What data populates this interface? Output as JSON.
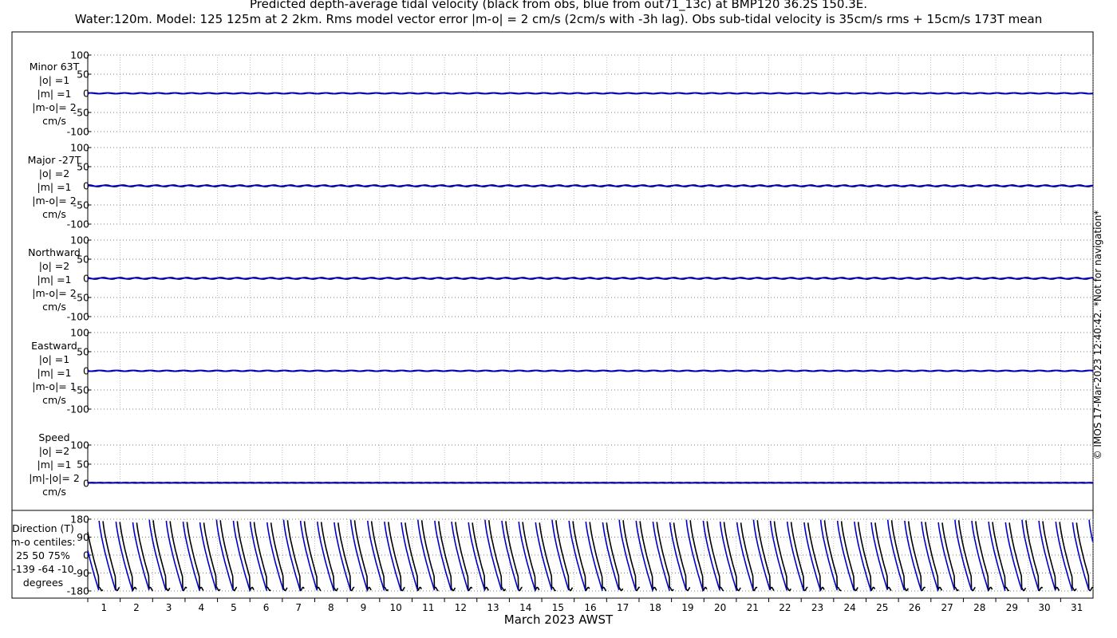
{
  "title_line1": "Predicted depth-average tidal velocity (black from obs, blue from out71_13c) at BMP120 36.2S 150.3E.",
  "title_line2": "Water:120m. Model: 125 125m at 2 2km. Rms model vector error |m-o| = 2 cm/s (2cm/s with -3h lag). Obs sub-tidal velocity is 35cm/s rms + 15cm/s 173T mean",
  "xlabel": "March 2023 AWST",
  "copyright": "© IMOS 17-Mar-2023 12:40:42. *Not for navigation*",
  "colors": {
    "obs": "#000000",
    "model": "#0000cc",
    "grid": "#999999"
  },
  "chart_data": [
    {
      "type": "line",
      "panel": "minor",
      "side_lines": [
        "Minor 63T",
        "|o| =1",
        "|m| =1",
        "|m-o|= 2",
        "cm/s"
      ],
      "yticks": [
        "100",
        "50",
        "0",
        "-50",
        "-100"
      ],
      "ylim": [
        -100,
        100
      ],
      "xlim": [
        0,
        31
      ],
      "series": [
        {
          "name": "obs",
          "amplitude": 1
        },
        {
          "name": "model",
          "amplitude": 1
        }
      ]
    },
    {
      "type": "line",
      "panel": "major",
      "side_lines": [
        "Major -27T",
        "|o| =2",
        "|m| =1",
        "|m-o|= 2",
        "cm/s"
      ],
      "yticks": [
        "100",
        "50",
        "0",
        "-50",
        "-100"
      ],
      "ylim": [
        -100,
        100
      ],
      "xlim": [
        0,
        31
      ],
      "series": [
        {
          "name": "obs",
          "amplitude": 2
        },
        {
          "name": "model",
          "amplitude": 1
        }
      ]
    },
    {
      "type": "line",
      "panel": "northward",
      "side_lines": [
        "Northward",
        "|o| =2",
        "|m| =1",
        "|m-o|= 2",
        "cm/s"
      ],
      "yticks": [
        "100",
        "50",
        "0",
        "-50",
        "-100"
      ],
      "ylim": [
        -100,
        100
      ],
      "xlim": [
        0,
        31
      ],
      "series": [
        {
          "name": "obs",
          "amplitude": 2
        },
        {
          "name": "model",
          "amplitude": 1
        }
      ]
    },
    {
      "type": "line",
      "panel": "eastward",
      "side_lines": [
        "Eastward",
        "|o| =1",
        "|m| =1",
        "|m-o|= 1",
        "cm/s"
      ],
      "yticks": [
        "100",
        "50",
        "0",
        "-50",
        "-100"
      ],
      "ylim": [
        -100,
        100
      ],
      "xlim": [
        0,
        31
      ],
      "series": [
        {
          "name": "obs",
          "amplitude": 1
        },
        {
          "name": "model",
          "amplitude": 1
        }
      ]
    },
    {
      "type": "line",
      "panel": "speed",
      "side_lines": [
        "Speed",
        "|o| =2",
        "|m| =1",
        "|m|-|o|= 2",
        "cm/s"
      ],
      "yticks": [
        "100",
        "50",
        "0"
      ],
      "ylim": [
        0,
        100
      ],
      "xlim": [
        0,
        31
      ],
      "series": [
        {
          "name": "obs",
          "amplitude": 2
        },
        {
          "name": "model",
          "amplitude": 1
        }
      ]
    },
    {
      "type": "line",
      "panel": "direction",
      "side_lines": [
        "Direction (T)",
        "m-o centiles:",
        "25  50  75%",
        "-139  -64  -10",
        "degrees"
      ],
      "yticks": [
        "180",
        "90",
        "0",
        "-90",
        "-180"
      ],
      "ylim": [
        -180,
        180
      ],
      "xlim": [
        0,
        31
      ],
      "series": [
        {
          "name": "obs"
        },
        {
          "name": "model"
        }
      ]
    }
  ],
  "x_ticks": [
    "1",
    "2",
    "3",
    "4",
    "5",
    "6",
    "7",
    "8",
    "9",
    "10",
    "11",
    "12",
    "13",
    "14",
    "15",
    "16",
    "17",
    "18",
    "19",
    "20",
    "21",
    "22",
    "23",
    "24",
    "25",
    "26",
    "27",
    "28",
    "29",
    "30",
    "31"
  ]
}
